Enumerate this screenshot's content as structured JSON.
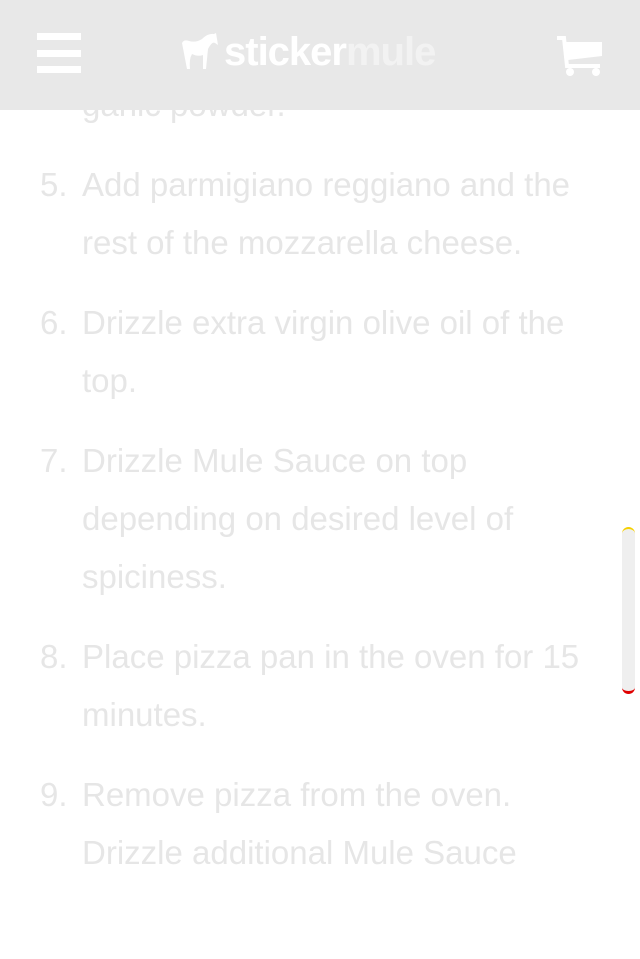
{
  "header": {
    "logo_part1": "sticker",
    "logo_part2": "mule",
    "menu_icon": "hamburger-icon",
    "cart_icon": "cart-icon"
  },
  "steps": {
    "prev_tail": "garlic powder.",
    "items": [
      {
        "num": "5.",
        "text": "Add parmigiano reggiano and the rest of the mozzarella cheese."
      },
      {
        "num": "6.",
        "text": "Drizzle extra virgin olive oil of the top."
      },
      {
        "num": "7.",
        "text": "Drizzle Mule Sauce on top depending on desired level of spiciness."
      },
      {
        "num": "8.",
        "text": "Place pizza pan in the oven for 15 minutes."
      },
      {
        "num": "9.",
        "text": "Remove pizza from the oven. Drizzle additional Mule Sauce"
      }
    ]
  }
}
